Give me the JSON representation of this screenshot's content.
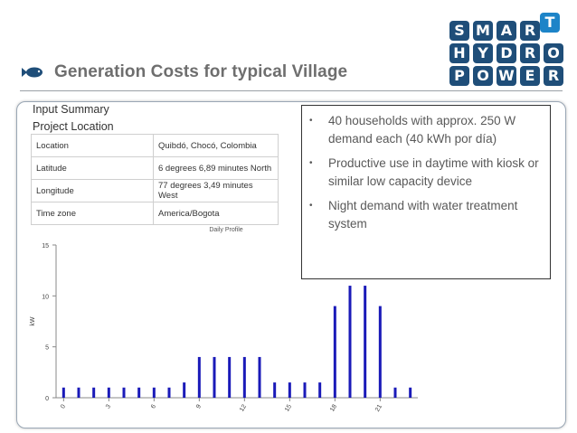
{
  "logo": {
    "tiles": [
      "S",
      "M",
      "A",
      "R",
      "T",
      "H",
      "Y",
      "D",
      "R",
      "O",
      "P",
      "O",
      "W",
      "E",
      "R"
    ]
  },
  "slide": {
    "title": "Generation Costs for typical Village"
  },
  "summary": {
    "heading": "Input Summary",
    "subheading": "Project Location",
    "rows": [
      {
        "label": "Location",
        "value": "Quibdó, Chocó, Colombia"
      },
      {
        "label": "Latitude",
        "value": "6 degrees 6,89 minutes North"
      },
      {
        "label": "Longitude",
        "value": "77 degrees 3,49 minutes West"
      },
      {
        "label": "Time zone",
        "value": "America/Bogota"
      }
    ]
  },
  "notes": {
    "items": [
      "40 households with approx. 250 W demand each (40 kWh por día)",
      "Productive use in daytime with kiosk or similar low capacity device",
      "Night demand with water treatment system"
    ]
  },
  "colors": {
    "bar": "#1a1ab8",
    "logo_dark": "#1f4e79",
    "logo_accent": "#1d84c8",
    "title": "#6e6e6e"
  },
  "chart_data": {
    "type": "bar",
    "title": "Daily Profile",
    "xlabel": "",
    "ylabel": "kW",
    "categories": [
      0,
      1,
      2,
      3,
      4,
      5,
      6,
      7,
      8,
      9,
      10,
      11,
      12,
      13,
      14,
      15,
      16,
      17,
      18,
      19,
      20,
      21,
      22,
      23
    ],
    "x_tick_labels": [
      "0",
      "3",
      "6",
      "9",
      "12",
      "15",
      "18",
      "21"
    ],
    "values": [
      1,
      1,
      1,
      1,
      1,
      1,
      1,
      1,
      1.5,
      4,
      4,
      4,
      4,
      4,
      1.5,
      1.5,
      1.5,
      1.5,
      9,
      11,
      11,
      9,
      1,
      1
    ],
    "ylim": [
      0,
      15
    ],
    "y_ticks": [
      0,
      5,
      10,
      15
    ],
    "grid": false
  }
}
